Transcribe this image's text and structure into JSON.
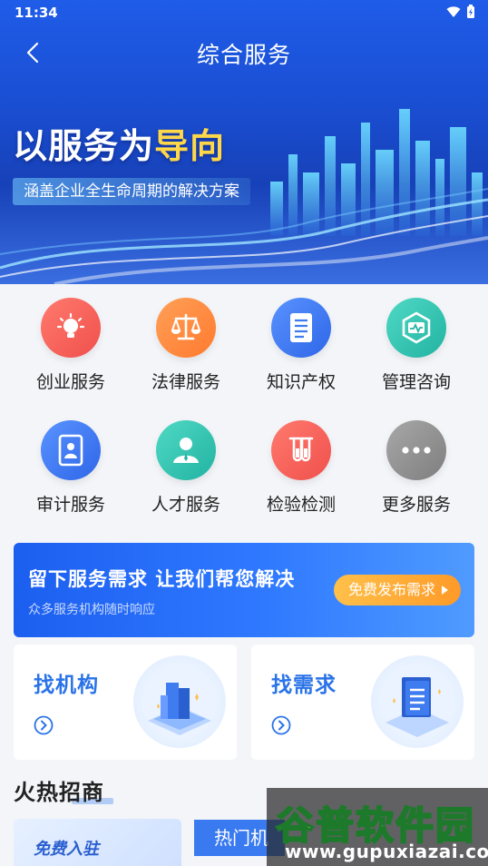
{
  "status_bar": {
    "time": "11:34"
  },
  "header": {
    "title": "综合服务"
  },
  "hero": {
    "slogan_main": "以服务为",
    "slogan_accent": "导向",
    "subtitle": "涵盖企业全生命周期的解决方案"
  },
  "services": [
    {
      "label": "创业服务",
      "icon": "lightbulb-icon",
      "color": "#f2605a"
    },
    {
      "label": "法律服务",
      "icon": "scales-icon",
      "color": "#ff8a3d"
    },
    {
      "label": "知识产权",
      "icon": "document-icon",
      "color": "#3f7cf0"
    },
    {
      "label": "管理咨询",
      "icon": "consult-chart-icon",
      "color": "#35c7b4"
    },
    {
      "label": "审计服务",
      "icon": "audit-person-icon",
      "color": "#3f7cf0"
    },
    {
      "label": "人才服务",
      "icon": "person-icon",
      "color": "#35c7b4"
    },
    {
      "label": "检验检测",
      "icon": "test-tubes-icon",
      "color": "#f2605a"
    },
    {
      "label": "更多服务",
      "icon": "more-dots-icon",
      "color": "#8f8f8f"
    }
  ],
  "demand": {
    "title": "留下服务需求 让我们帮您解决",
    "subtitle": "众多服务机构随时响应",
    "button": "免费发布需求"
  },
  "find_cards": [
    {
      "title": "找机构",
      "icon": "buildings-icon"
    },
    {
      "title": "找需求",
      "icon": "clipboard-icon"
    }
  ],
  "hot": {
    "title": "火热招商",
    "free_card": "免费入驻",
    "tab": "热门机"
  },
  "watermark": {
    "main": "谷普软件园",
    "url": "www.gupuxiazai.com"
  }
}
